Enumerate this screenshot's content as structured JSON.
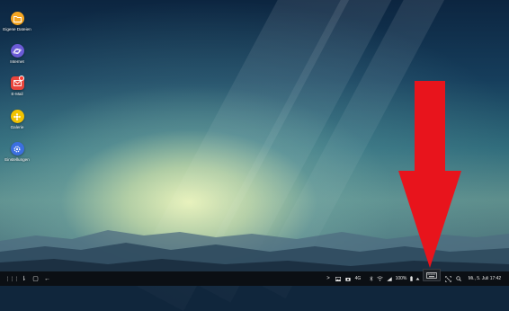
{
  "desktop": {
    "icons": [
      {
        "label": "Eigene Dateien",
        "icon": "folder-icon",
        "color": "#f5a623"
      },
      {
        "label": "Internet",
        "icon": "planet-icon",
        "color": "#6b5bd6"
      },
      {
        "label": "E-Mail",
        "icon": "mail-icon",
        "color": "#e8453c"
      },
      {
        "label": "Galerie",
        "icon": "flower-icon",
        "color": "#f2c200"
      },
      {
        "label": "Einstellungen",
        "icon": "gear-icon",
        "color": "#3b6fe0"
      }
    ]
  },
  "annotation": {
    "arrow_color": "#e8141c",
    "points_to": "keyboard-icon"
  },
  "taskbar": {
    "left_buttons": [
      {
        "icon": "apps-grid-icon",
        "glyph": "⋮⋮⋮"
      },
      {
        "icon": "recents-icon",
        "glyph": "⇂"
      },
      {
        "icon": "home-icon",
        "glyph": "▢"
      },
      {
        "icon": "back-icon",
        "glyph": "←"
      }
    ],
    "tray": {
      "expand_glyph": ">",
      "battery": "100%",
      "network_label": "4G",
      "datetime": "Mi., 5. Juli 17:42"
    }
  }
}
